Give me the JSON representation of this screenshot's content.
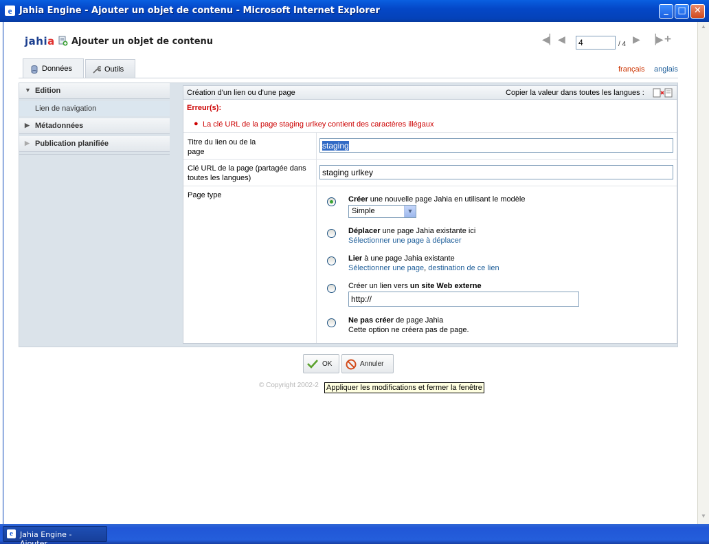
{
  "window": {
    "title": "Jahia Engine - Ajouter un objet de contenu - Microsoft Internet Explorer",
    "minimize_label": "_",
    "maximize_label": "□",
    "close_label": "✕"
  },
  "header": {
    "logo_main": "jahi",
    "logo_accent": "a",
    "page_title": "Ajouter un objet de contenu",
    "pager": {
      "current": "4",
      "total_label": "/ 4"
    }
  },
  "tabs": [
    {
      "label": "Données",
      "active": true
    },
    {
      "label": "Outils",
      "active": false
    }
  ],
  "languages": {
    "fr": "français",
    "en": "anglais"
  },
  "sidebar": {
    "sections": [
      {
        "label": "Edition",
        "expanded": true
      },
      {
        "label": "Métadonnées",
        "expanded": false
      },
      {
        "label": "Publication planifiée",
        "expanded": false
      }
    ],
    "items": [
      {
        "label": "Lien de navigation"
      }
    ]
  },
  "form": {
    "heading": "Création d'un lien ou d'une page",
    "copy_all_label": "Copier la valeur dans toutes les langues :",
    "error_title": "Erreur(s):",
    "error_message": "La clé URL de la page staging urlkey contient des caractères illégaux",
    "fields": {
      "title": {
        "label_1": "Titre du lien ou de la",
        "label_2": "page",
        "value": "staging"
      },
      "url_key": {
        "label_1": "Clé URL de la page (partagée dans",
        "label_2": "toutes les langues)",
        "value": "staging urlkey"
      },
      "page_type": {
        "label": "Page type"
      }
    },
    "options": {
      "create": {
        "bold": "Créer",
        "rest": " une nouvelle page Jahia en utilisant le modèle",
        "template": "Simple"
      },
      "move": {
        "bold": "Déplacer",
        "rest": " une page Jahia existante ici",
        "link": "Sélectionner une page à déplacer"
      },
      "link": {
        "bold": "Lier",
        "rest": " à une page Jahia existante",
        "link1": "Sélectionner une page",
        "sep": ", ",
        "link2": "destination de ce lien"
      },
      "external": {
        "pre": "Créer un lien vers ",
        "bold": "un site Web externe",
        "value": "http://"
      },
      "none": {
        "bold": "Ne pas créer",
        "rest": " de page Jahia",
        "desc": "Cette option ne créera pas de page."
      }
    }
  },
  "buttons": {
    "ok": "OK",
    "cancel": "Annuler"
  },
  "footer": {
    "copyright": "© Copyright 2002-2"
  },
  "tooltip": "Appliquer les modifications et fermer la fenêtre",
  "taskbar": {
    "item": "Jahia Engine - Ajouter..."
  },
  "colors": {
    "error": "#cc0000",
    "link": "#1f5f9a",
    "lang_active": "#cc3300"
  }
}
